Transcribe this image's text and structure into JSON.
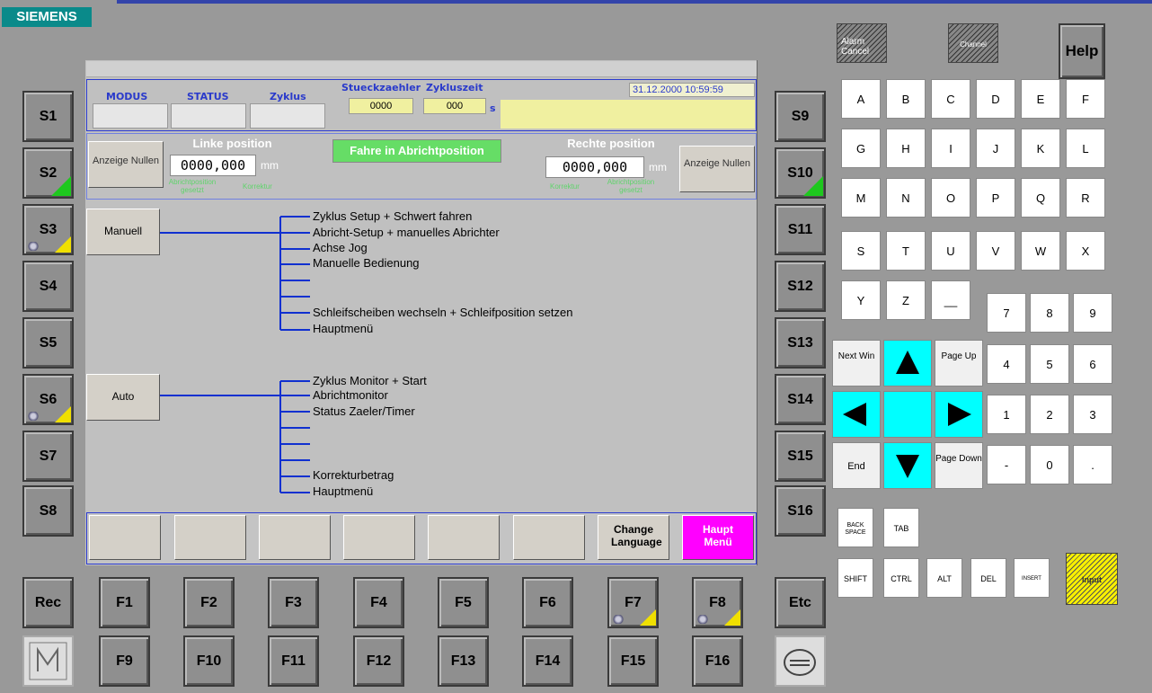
{
  "brand": "SIEMENS",
  "left_softkeys": [
    "S1",
    "S2",
    "S3",
    "S4",
    "S5",
    "S6",
    "S7",
    "S8"
  ],
  "right_softkeys": [
    "S9",
    "S10",
    "S11",
    "S12",
    "S13",
    "S14",
    "S15",
    "S16"
  ],
  "bottom_keys_row1": [
    "F1",
    "F2",
    "F3",
    "F4",
    "F5",
    "F6",
    "F7",
    "F8"
  ],
  "bottom_keys_row2": [
    "F9",
    "F10",
    "F11",
    "F12",
    "F13",
    "F14",
    "F15",
    "F16"
  ],
  "rec_label": "Rec",
  "etc_label": "Etc",
  "help_label": "Help",
  "alarm_cancel_label": "Alarm Cancel",
  "channel_label": "Channel",
  "header": {
    "modus_label": "MODUS",
    "status_label": "STATUS",
    "zyklus_label": "Zyklus",
    "stueckzaehler_label": "Stueckzaehler",
    "zykluszeit_label": "Zykluszeit",
    "stueckzaehler_value": "0000",
    "zykluszeit_value": "000",
    "zykluszeit_unit": "s",
    "datetime": "31.12.2000 10:59:59"
  },
  "left_pos": {
    "button": "Anzeige Nullen",
    "title": "Linke position",
    "value": "0000,000",
    "unit": "mm",
    "sub1": "Abrichtposition gesetzt",
    "sub2": "Korrektur"
  },
  "right_pos": {
    "button": "Anzeige Nullen",
    "title": "Rechte position",
    "value": "0000,000",
    "unit": "mm",
    "sub1": "Korrektur",
    "sub2": "Abrichtposition gesetzt"
  },
  "status_message": "Fahre in Abrichtposition",
  "manuell": {
    "label": "Manuell",
    "items": [
      "Zyklus Setup + Schwert fahren",
      "Abricht-Setup + manuelles Abrichter",
      "Achse Jog",
      "Manuelle Bedienung",
      "",
      "",
      "Schleifscheiben wechseln + Schleifposition setzen",
      "Hauptmenü"
    ]
  },
  "auto": {
    "label": "Auto",
    "items": [
      "Zyklus Monitor + Start",
      "Abrichtmonitor",
      "Status Zaeler/Timer",
      "",
      "",
      "",
      "Korrekturbetrag",
      "Hauptmenü"
    ]
  },
  "hsk": {
    "change_language": "Change Language",
    "haupt_menu": "Haupt Menü"
  },
  "letters": [
    "A",
    "B",
    "C",
    "D",
    "E",
    "F",
    "G",
    "H",
    "I",
    "J",
    "K",
    "L",
    "M",
    "N",
    "O",
    "P",
    "Q",
    "R",
    "S",
    "T",
    "U",
    "V",
    "W",
    "X",
    "Y",
    "Z",
    "__"
  ],
  "numpad": [
    "7",
    "8",
    "9",
    "4",
    "5",
    "6",
    "1",
    "2",
    "3",
    "-",
    "0",
    "."
  ],
  "nav": {
    "next_win": "Next Win",
    "page_up": "Page Up",
    "end": "End",
    "page_down": "Page Down"
  },
  "mods": {
    "backspace": "BACK SPACE",
    "tab": "TAB",
    "shift": "SHIFT",
    "ctrl": "CTRL",
    "alt": "ALT",
    "del": "DEL",
    "insert": "INSERT",
    "input": "Input"
  },
  "colors": {
    "accent_blue": "#2b3ad0",
    "tree_blue": "#1030d0",
    "status_green": "#66dd66",
    "haupt_magenta": "#ff00ff",
    "cyan": "#00ffff"
  }
}
